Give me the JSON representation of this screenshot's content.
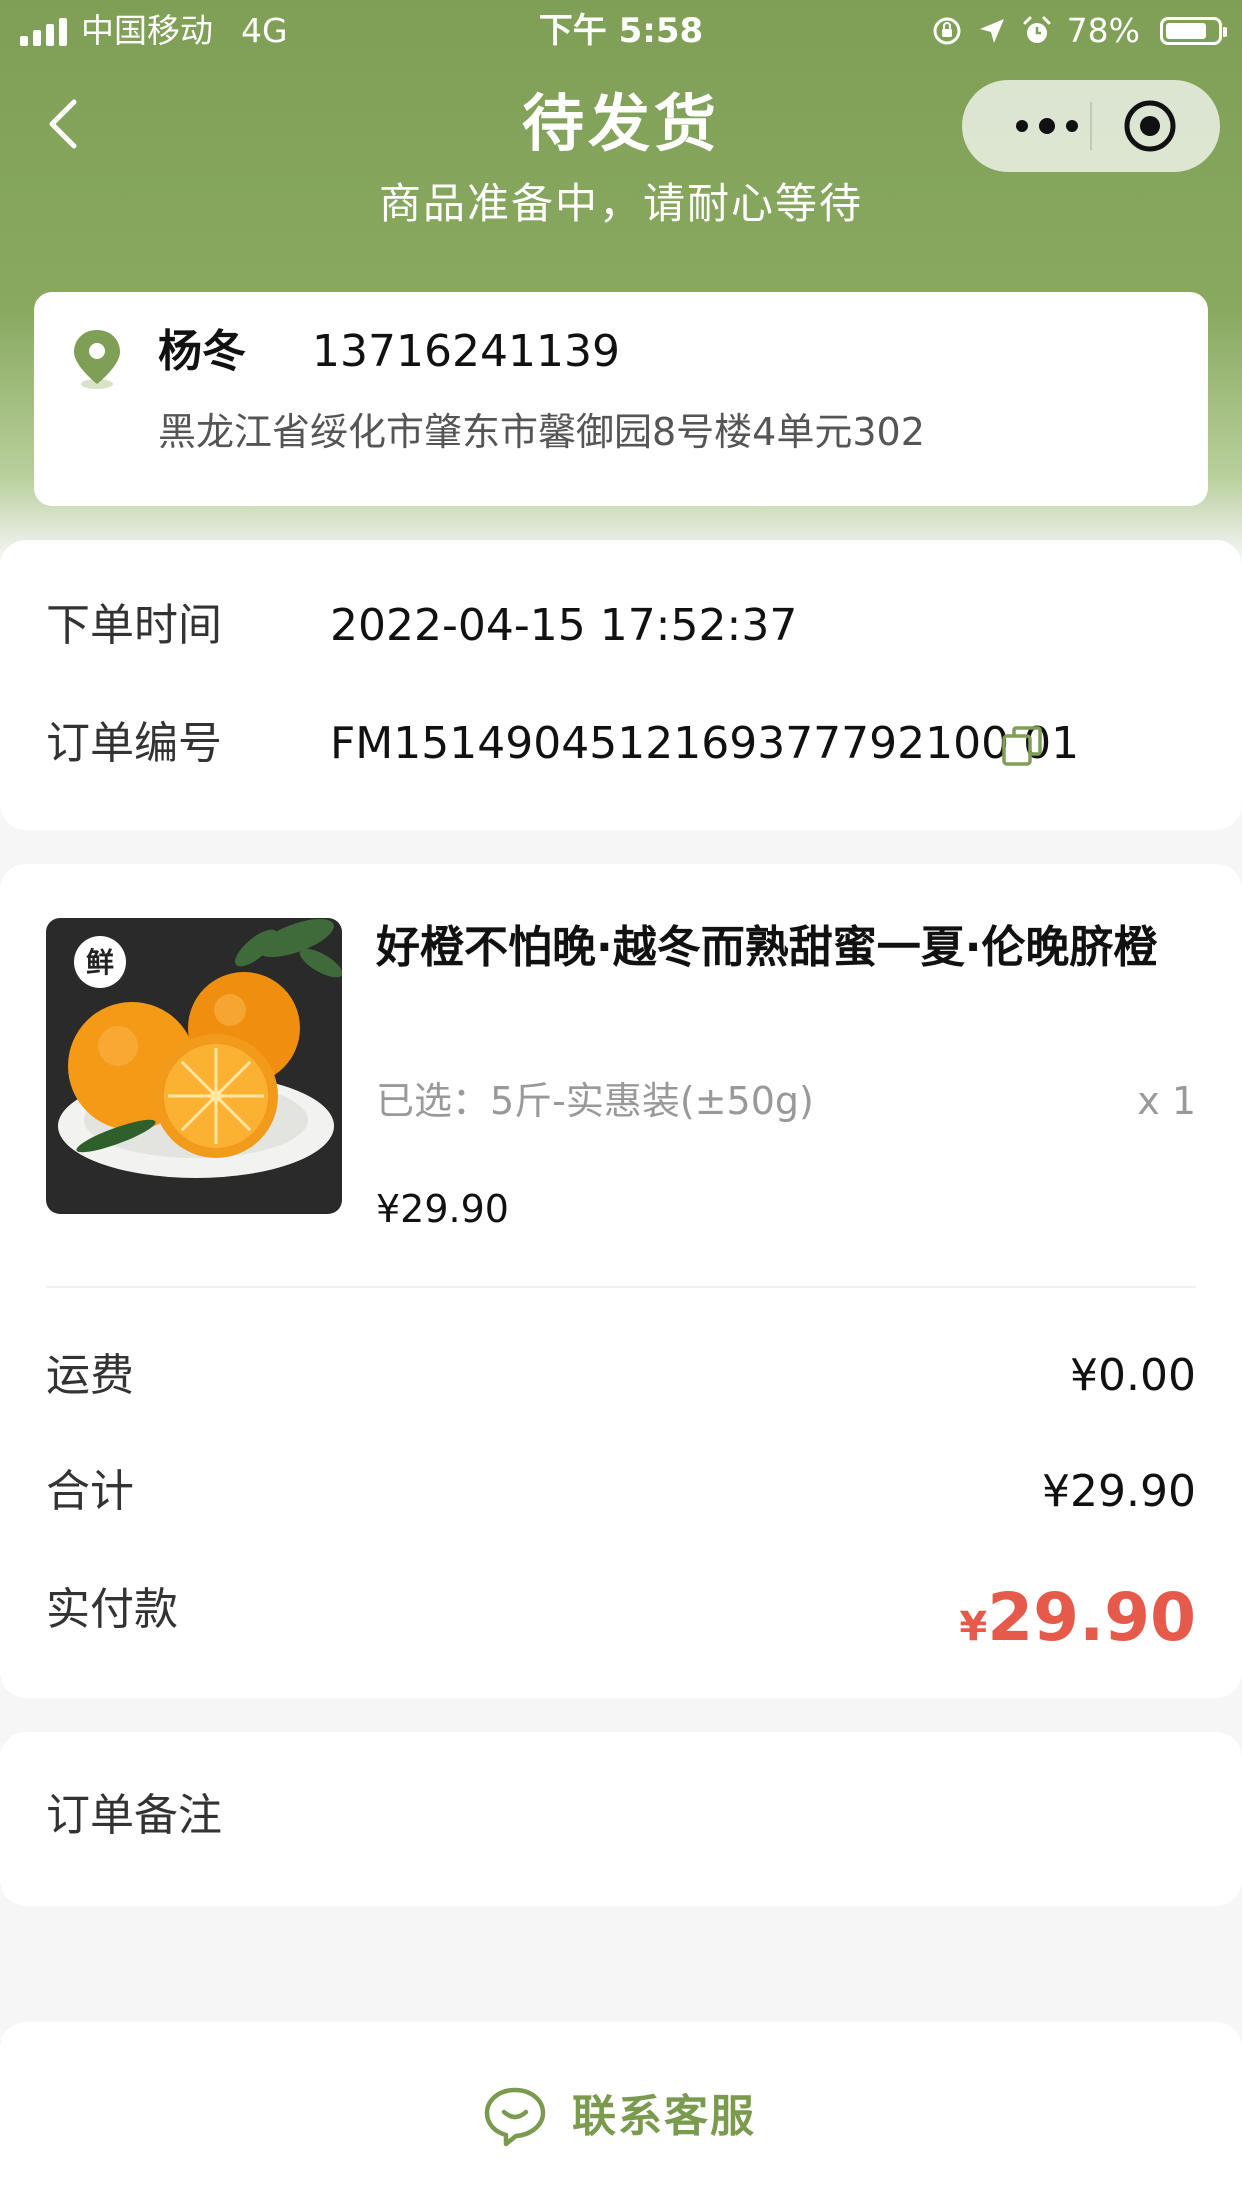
{
  "status_bar": {
    "carrier": "中国移动",
    "network": "4G",
    "time": "下午 5:58",
    "battery": "78%"
  },
  "header": {
    "title": "待发货",
    "subtitle": "商品准备中，请耐心等待"
  },
  "address": {
    "name": "杨冬",
    "phone": "13716241139",
    "detail": "黑龙江省绥化市肇东市馨御园8号楼4单元302"
  },
  "order_info": {
    "time_label": "下单时间",
    "time_value": "2022-04-15 17:52:37",
    "number_label": "订单编号",
    "number_value": "FM1514904512169377792100 01"
  },
  "product": {
    "title": "好橙不怕晚·越冬而熟甜蜜一夏·伦晚脐橙",
    "spec": "已选：5斤-实惠装(±50g)",
    "qty": "x 1",
    "price": "¥29.90",
    "image_badge": "鲜"
  },
  "fees": {
    "shipping_label": "运费",
    "shipping_value": "¥0.00",
    "total_label": "合计",
    "total_value": "¥29.90",
    "paid_label": "实付款",
    "paid_symbol": "¥",
    "paid_value": "29.90"
  },
  "remark": {
    "label": "订单备注"
  },
  "bottom": {
    "contact_label": "联系客服"
  },
  "colors": {
    "brand_green": "#7f9f56",
    "accent_red": "#e65a4c",
    "button_green": "#7a9a4e"
  }
}
